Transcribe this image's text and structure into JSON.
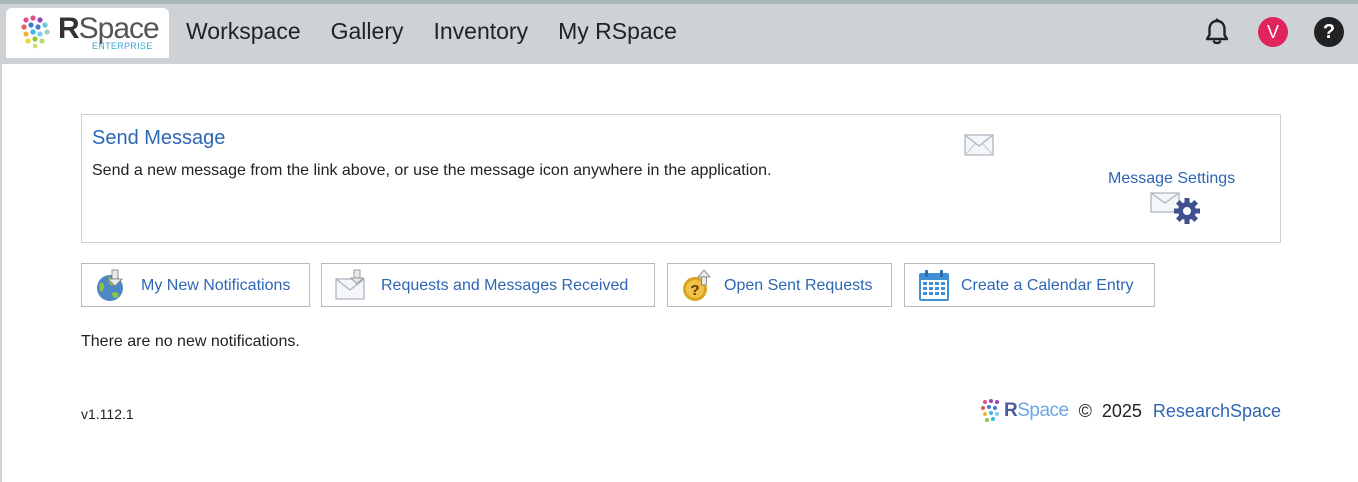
{
  "brand": {
    "name_bold": "R",
    "name_rest": "Space",
    "edition": "ENTERPRISE"
  },
  "nav": {
    "items": [
      "Workspace",
      "Gallery",
      "Inventory",
      "My RSpace"
    ]
  },
  "user": {
    "avatar_initial": "V"
  },
  "help": {
    "symbol": "?"
  },
  "send_message": {
    "title": "Send Message",
    "description": "Send a new message from the link above, or use the message icon anywhere in the application.",
    "settings_label": "Message Settings"
  },
  "buttons": {
    "notifications": "My New Notifications",
    "received": "Requests and Messages Received",
    "sent": "Open Sent Requests",
    "calendar": "Create a Calendar Entry"
  },
  "status": {
    "no_notifications": "There are no new notifications."
  },
  "footer": {
    "version": "v1.112.1",
    "logo_bold": "R",
    "logo_rest": "Space",
    "copyright": "©",
    "year": "2025",
    "company": "ResearchSpace"
  },
  "colors": {
    "topbar": "#cdd2d6",
    "link": "#2e66b4",
    "avatar": "#e0245e"
  }
}
